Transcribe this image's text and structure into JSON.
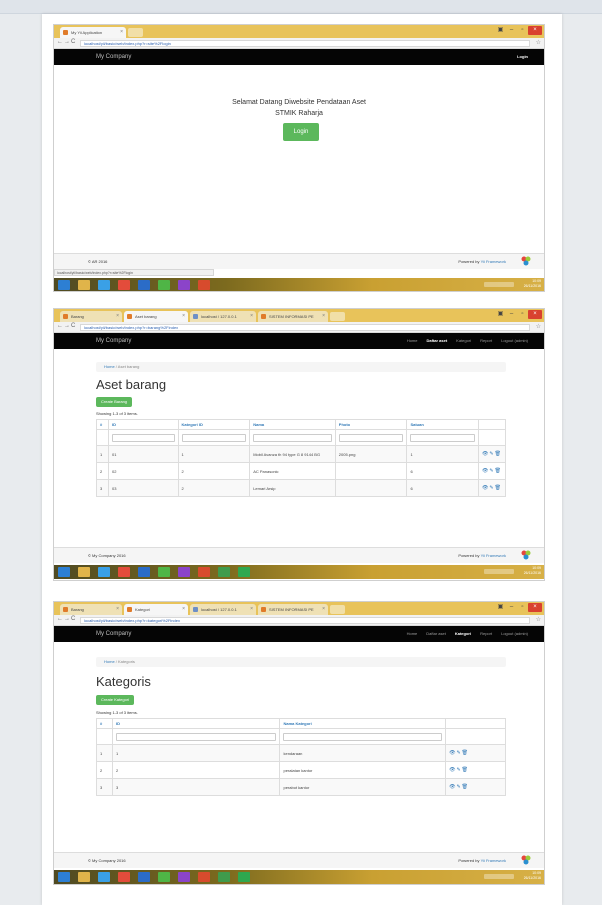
{
  "browser": {
    "address_url": "localhost/yii/basic/web/index.php?r=site%2Flogin",
    "address_url_aset": "localhost/yii/basic/web/index.php?r=barang%2Findex",
    "address_url_kategori": "localhost/yii/basic/web/index.php?r=kategori%2Findex",
    "tab_app": "My Yii Application",
    "tab_barang": "Barang",
    "tab_aset": "Aset barang",
    "tab_kategori": "Kategori",
    "tab_localhost": "localhost / 127.0.0.1",
    "tab_sistem": "SISTEM INFORMASI PE"
  },
  "brand": "My Company",
  "nav": {
    "home": "Home",
    "daftar_aset": "Daftar aset",
    "kategori": "Kategori",
    "report": "Report",
    "logout": "Logout (admin)",
    "login": "Login"
  },
  "login_page": {
    "welcome_line1": "Selamat Datang Diwebsite Pendataan Aset",
    "welcome_line2": "STMIK Raharja",
    "login_button": "Login",
    "footer_left": "© AR 2016",
    "status_url": "localhost/yii/basic/web/index.php?r=site%2Flogin"
  },
  "aset_page": {
    "breadcrumb_home": "Home",
    "breadcrumb_current": "Aset barang",
    "title": "Aset barang",
    "create_button": "Create Barang",
    "summary": "Showing 1-3 of 3 items.",
    "columns": [
      "#",
      "ID",
      "Kategori ID",
      "Nama",
      "Photo",
      "Satuan"
    ],
    "rows": [
      [
        "1",
        "01",
        "1",
        "Mobil Avanza th 94 type G 8 9144 BG",
        "2005.png",
        "1"
      ],
      [
        "2",
        "02",
        "2",
        "AC Panasonic",
        "",
        "6"
      ],
      [
        "3",
        "03",
        "2",
        "Lemari Arsip",
        "",
        "6"
      ]
    ],
    "footer_left": "© My Company 2016"
  },
  "kategori_page": {
    "breadcrumb_home": "Home",
    "breadcrumb_current": "Kategoris",
    "title": "Kategoris",
    "create_button": "Create Kategori",
    "summary": "Showing 1-3 of 3 items.",
    "columns": [
      "#",
      "ID",
      "Nama Kategori"
    ],
    "rows": [
      [
        "1",
        "1",
        "kendaraan"
      ],
      [
        "2",
        "2",
        "peralatan kantor"
      ],
      [
        "3",
        "3",
        "perabot kantor"
      ]
    ],
    "footer_left": "© My Company 2016"
  },
  "footer": {
    "powered_prefix": "Powered by",
    "powered_link": "Yii Framework"
  },
  "tray_time": "10:09",
  "tray_date": "26/11/2016",
  "icons": {
    "windows": "windows-start-icon",
    "explorer": "file-explorer-icon",
    "ie": "internet-explorer-icon",
    "chrome": "chrome-icon"
  },
  "colors": {
    "navbar": "#050505",
    "success": "#5cb85c",
    "link": "#337ab7",
    "tabbar": "#e8c35a",
    "close": "#d9412f"
  }
}
